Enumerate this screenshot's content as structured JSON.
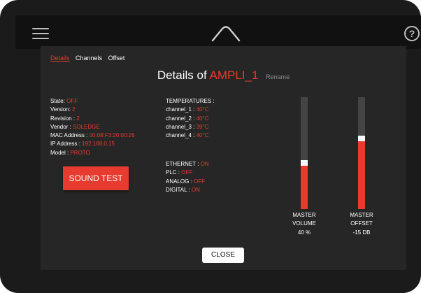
{
  "header": {
    "help_label": "?"
  },
  "modal": {
    "tabs": [
      {
        "label": "Details",
        "active": true
      },
      {
        "label": "Channels",
        "active": false
      },
      {
        "label": "Offset",
        "active": false
      }
    ],
    "title_prefix": "Details of",
    "ampli_name": "AMPLI_1",
    "rename_label": "Rename",
    "info": [
      {
        "label": "State",
        "value": "OFF"
      },
      {
        "label": "Version",
        "value": "2"
      },
      {
        "label": "Revision",
        "value": "2"
      },
      {
        "label": "Vendor",
        "value": "SOLEDGE"
      },
      {
        "label": "MAC Address",
        "value": "00:08:F3:20:00:26"
      },
      {
        "label": "IP Address",
        "value": "192.168.0.15"
      },
      {
        "label": "Model",
        "value": "PROTO"
      }
    ],
    "sound_test_label": "SOUND TEST",
    "temperatures_heading": "TEMPERATURES :",
    "temperatures": [
      {
        "label": "channel_1",
        "value": "40°C"
      },
      {
        "label": "channel_2",
        "value": "40°C"
      },
      {
        "label": "channel_3",
        "value": "39°C"
      },
      {
        "label": "channel_4",
        "value": "40°C"
      }
    ],
    "status": [
      {
        "label": "ETHERNET",
        "value": "ON"
      },
      {
        "label": "PLC",
        "value": "OFF"
      },
      {
        "label": "ANALOG",
        "value": "OFF"
      },
      {
        "label": "DIGITAL",
        "value": "ON"
      }
    ],
    "master_volume": {
      "line1": "MASTER",
      "line2": "VOLUME",
      "value_text": "40 %",
      "level": 0.4
    },
    "master_offset": {
      "line1": "MASTER",
      "line2": "OFFSET",
      "value_text": "-15 DB",
      "level": 0.62
    },
    "close_label": "CLOSE"
  },
  "colors": {
    "accent": "#e63b2e",
    "background": "#1b1b1b",
    "modal": "#262626",
    "track": "#444444"
  }
}
